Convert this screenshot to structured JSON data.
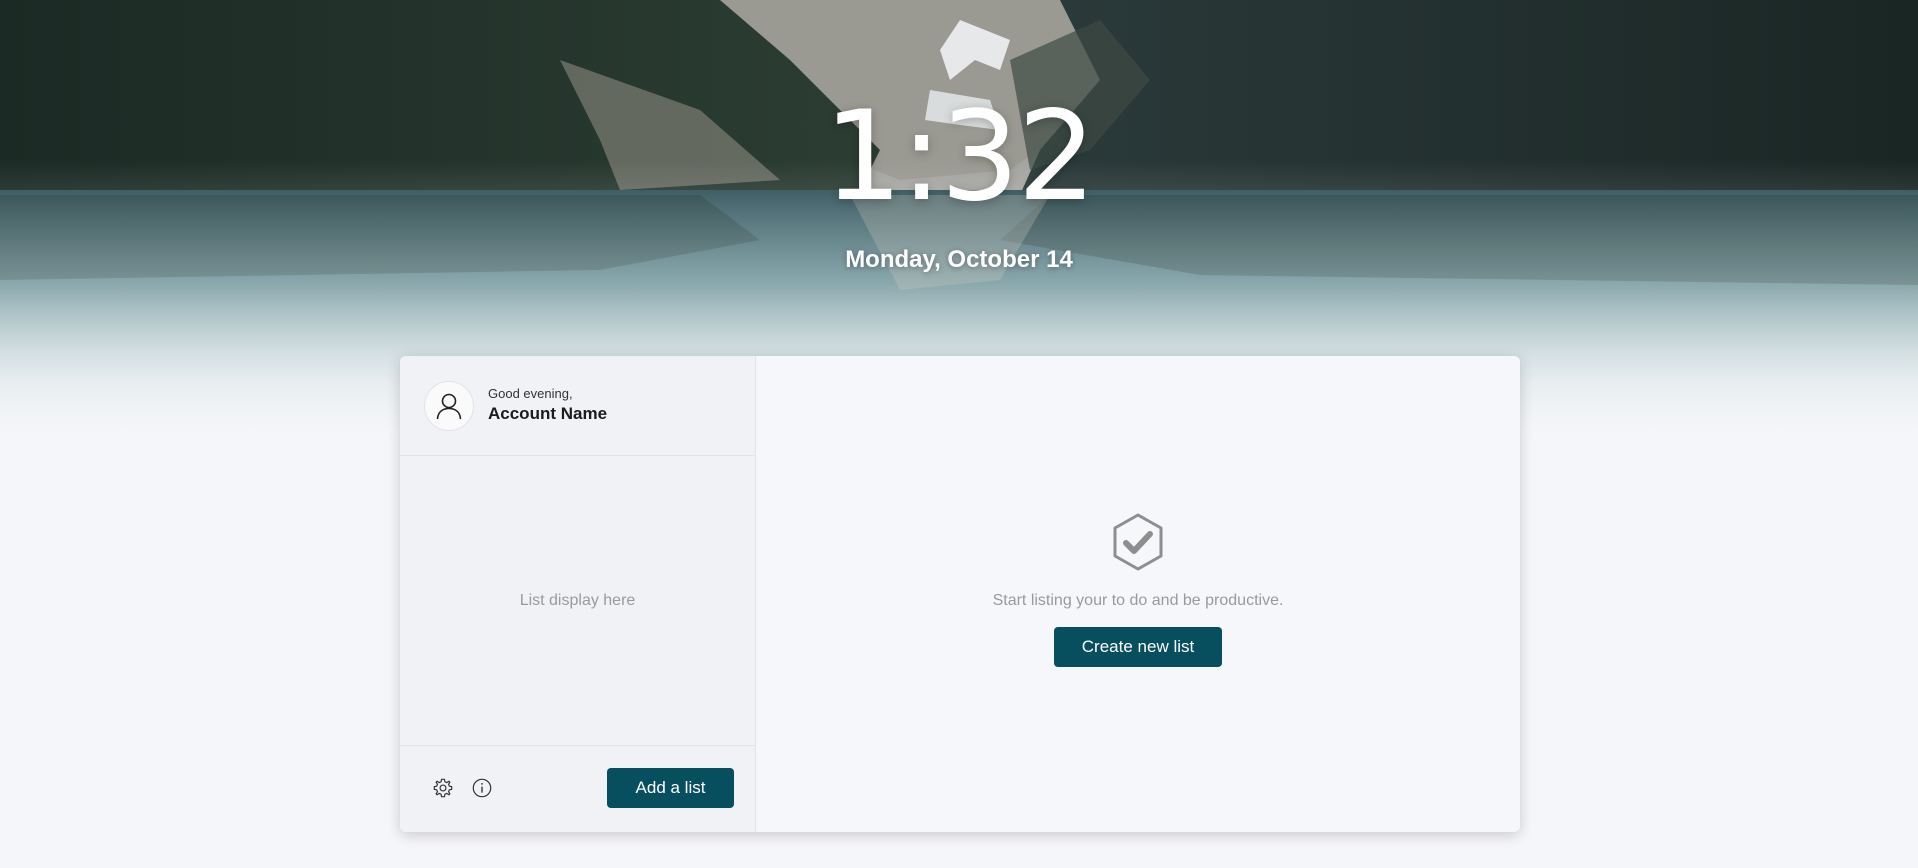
{
  "clock": {
    "time": "1:32",
    "date": "Monday, October 14"
  },
  "account": {
    "greeting": "Good evening,",
    "name": "Account Name",
    "avatar_icon": "user-icon"
  },
  "sidebar": {
    "list_placeholder": "List display here",
    "footer": {
      "settings_icon": "gear-icon",
      "info_icon": "info-icon",
      "add_list_label": "Add a list"
    }
  },
  "main": {
    "empty_icon": "hexagon-check-icon",
    "empty_message": "Start listing your to do and be productive.",
    "create_button_label": "Create new list"
  },
  "colors": {
    "primary": "#074e5f",
    "page_background": "#f5f6f9",
    "muted_text": "#9a9a9a"
  }
}
